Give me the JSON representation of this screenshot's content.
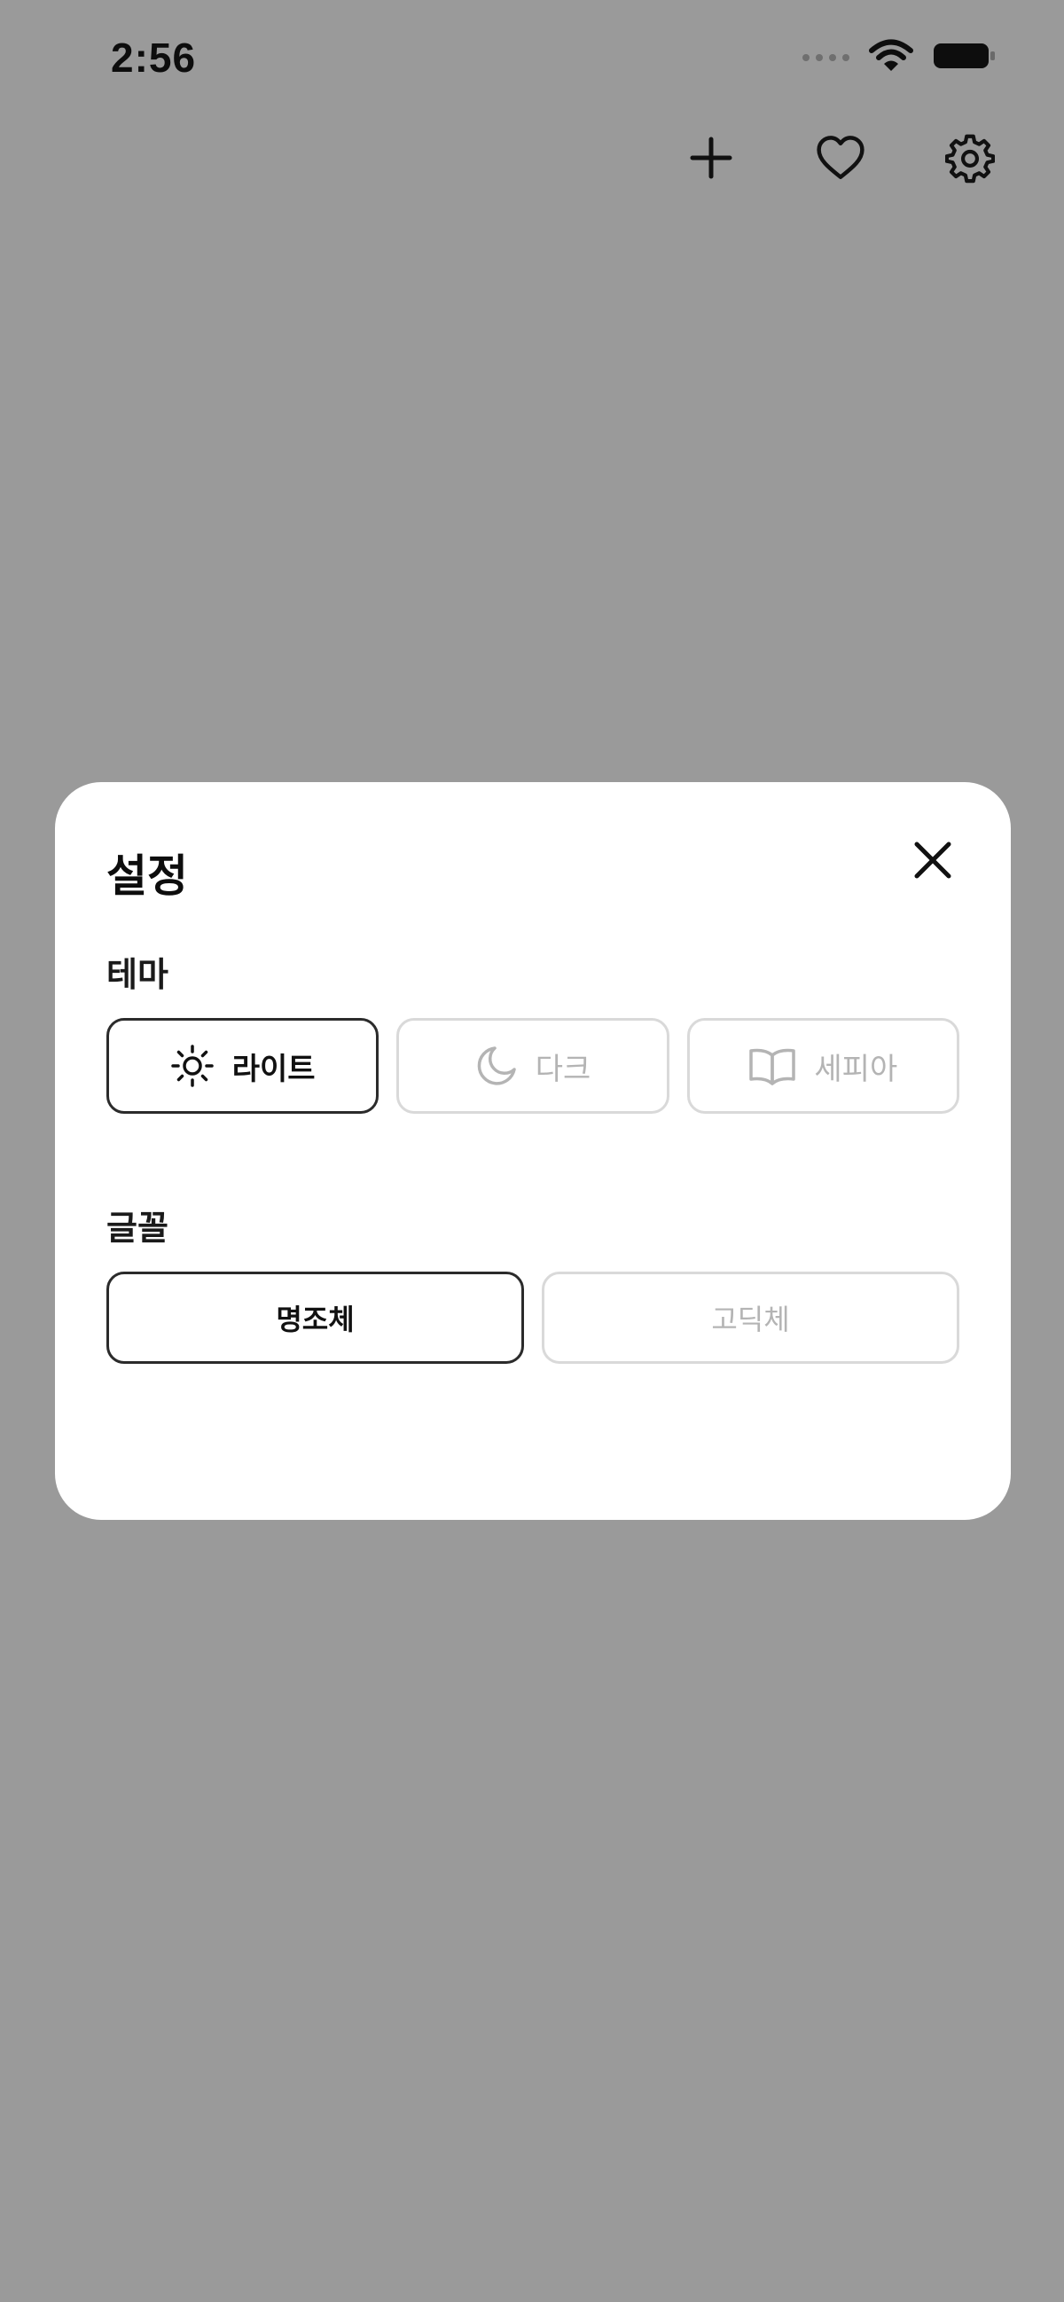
{
  "status_bar": {
    "time": "2:56",
    "icons": [
      "signal-dots",
      "wifi-icon",
      "battery-icon"
    ]
  },
  "toolbar": {
    "items": [
      {
        "icon": "plus-icon"
      },
      {
        "icon": "heart-icon"
      },
      {
        "icon": "gear-icon"
      }
    ]
  },
  "settings": {
    "title": "설정",
    "close_icon": "close-icon",
    "theme": {
      "label": "테마",
      "options": [
        {
          "label": "라이트",
          "icon": "sun-icon",
          "selected": true
        },
        {
          "label": "다크",
          "icon": "moon-icon",
          "selected": false
        },
        {
          "label": "세피아",
          "icon": "book-icon",
          "selected": false
        }
      ]
    },
    "font": {
      "label": "글꼴",
      "options": [
        {
          "label": "명조체",
          "selected": true
        },
        {
          "label": "고딕체",
          "selected": false
        }
      ]
    }
  },
  "colors": {
    "backdrop": "#9a9a9a",
    "modal_bg": "#ffffff",
    "selected_border": "#2b2b2b",
    "unselected_border": "#d9d9d9",
    "unselected_text": "#b4b4b4"
  }
}
